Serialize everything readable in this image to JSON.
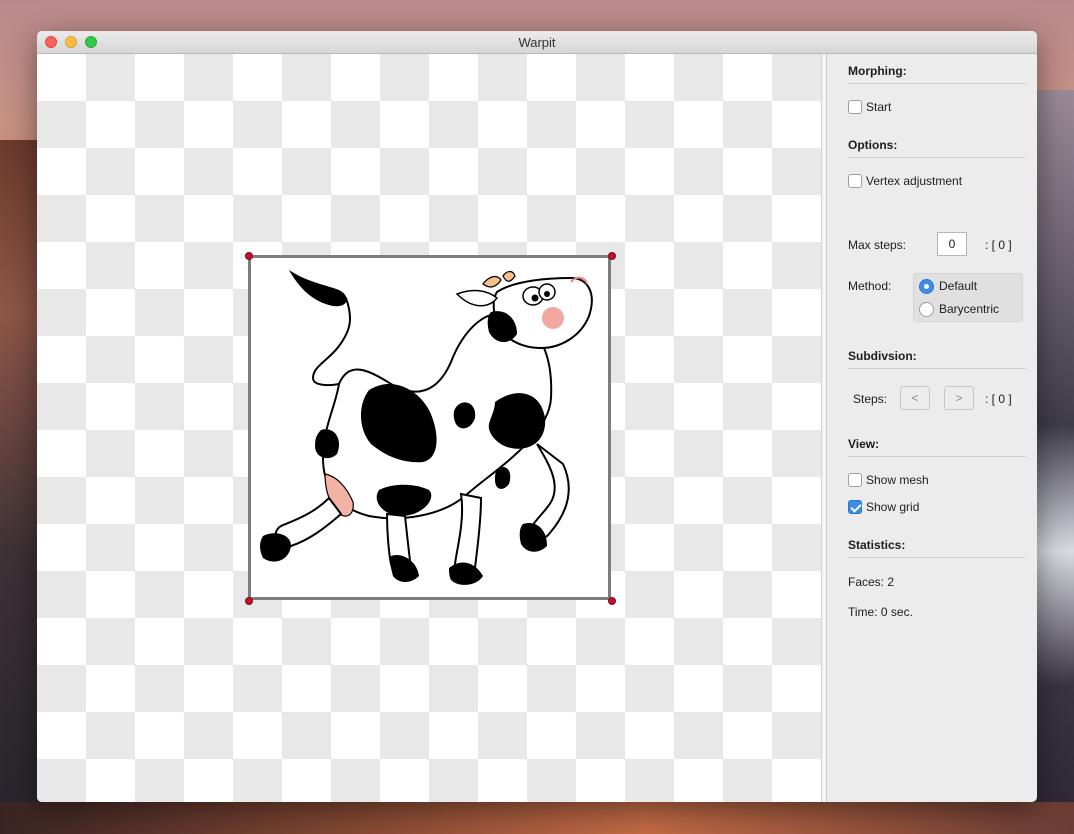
{
  "window": {
    "title": "Warpit"
  },
  "panel": {
    "morphing": {
      "title": "Morphing:",
      "start_label": "Start",
      "start_checked": false
    },
    "options": {
      "title": "Options:",
      "vertex_adjustment_label": "Vertex adjustment",
      "vertex_adjustment_checked": false,
      "max_steps_label": "Max steps:",
      "max_steps_value": "0",
      "max_steps_readout": ": [ 0 ]",
      "method_label": "Method:",
      "method_options": [
        "Default",
        "Barycentric"
      ],
      "method_selected": "Default"
    },
    "subdivision": {
      "title": "Subdivsion:",
      "steps_label": "Steps:",
      "prev_label": "<",
      "next_label": ">",
      "steps_readout": ": [ 0 ]"
    },
    "view": {
      "title": "View:",
      "show_mesh_label": "Show mesh",
      "show_mesh_checked": false,
      "show_grid_label": "Show grid",
      "show_grid_checked": true
    },
    "statistics": {
      "title": "Statistics:",
      "faces": "Faces: 2",
      "time": "Time: 0 sec."
    }
  },
  "canvas": {
    "image_subject": "cartoon-cow",
    "vertex_color": "#c8102e"
  },
  "colors": {
    "accent": "#3b8de8"
  }
}
